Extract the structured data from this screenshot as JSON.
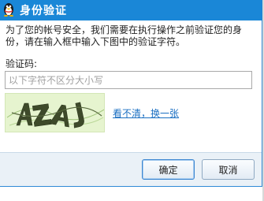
{
  "window": {
    "title": "身份验证",
    "icon": "qq-penguin-icon",
    "accent_color": "#1a87d7"
  },
  "description": {
    "line1": "为了您的帐号安全，我们需要在执行操作之前验证您的身",
    "line2": "份，请在输入框中输入下图中的验证字符。"
  },
  "form": {
    "label": "验证码:",
    "input_value": "",
    "input_placeholder": "以下字符不区分大小写"
  },
  "captcha": {
    "alt": "AZAJ",
    "refresh_link": "看不清，换一张"
  },
  "buttons": {
    "ok_label": "确定",
    "cancel_label": "取消"
  }
}
